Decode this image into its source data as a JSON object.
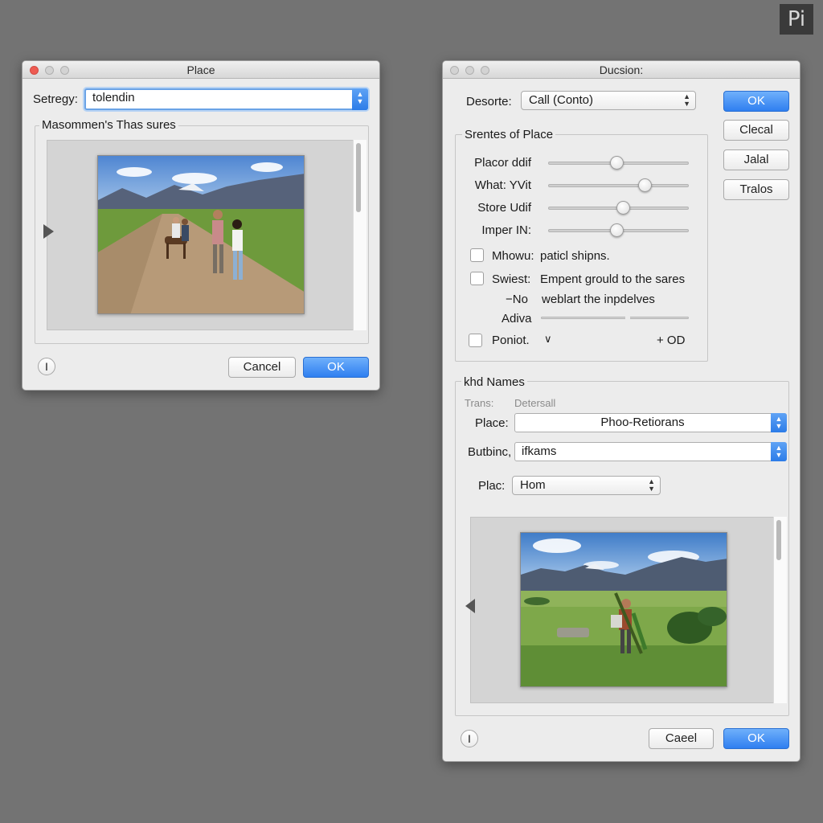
{
  "app_badge": "Pi",
  "place_dialog": {
    "title": "Place",
    "strategy_label": "Setregy:",
    "strategy_value": "tolendin",
    "group_title": "Masommen's Thas sures",
    "help_label": "I",
    "cancel_label": "Cancel",
    "ok_label": "OK"
  },
  "decision_dialog": {
    "title": "Ducsion:",
    "desorte_label": "Desorte:",
    "desorte_value": "Call (Conto)",
    "buttons": {
      "ok": "OK",
      "clecal": "Clecal",
      "jalal": "Jalal",
      "tralos": "Tralos"
    },
    "settings_group": {
      "title": "Srentes of Place",
      "sliders": [
        {
          "label": "Placor ddif",
          "value": 0.5
        },
        {
          "label": "What: YVit",
          "value": 0.7
        },
        {
          "label": "Store Udif",
          "value": 0.55
        },
        {
          "label": "Imper IN:",
          "value": 0.5
        }
      ],
      "check_mhowu": {
        "label": "Mhowu:",
        "text": "paticl shipns.",
        "checked": false
      },
      "check_swiest": {
        "label": "Swiest:",
        "text": "Empent grould to the sares",
        "checked": false
      },
      "no_label": "−No",
      "no_text": "weblart the inpdelves",
      "adiva_label": "Adiva",
      "adiva_value": 0.62,
      "poniot": {
        "label": "Poniot.",
        "caret": "∨",
        "add_label": "+ OD",
        "checked": false
      }
    },
    "names_group": {
      "title": "khd Names",
      "trans_label": "Trans:",
      "trans_value": "Detersall",
      "place_label": "Place:",
      "place_value": "Phoo-Retiorans",
      "butbinc_label": "Butbinc,",
      "butbinc_value": "ifkams",
      "plac_label": "Plac:",
      "plac_value": "Hom"
    },
    "help_label": "I",
    "cancel_label": "Caeel",
    "ok_label": "OK"
  },
  "colors": {
    "desktop": "#737373",
    "accent": "#2f7ff0",
    "window": "#ececec"
  }
}
